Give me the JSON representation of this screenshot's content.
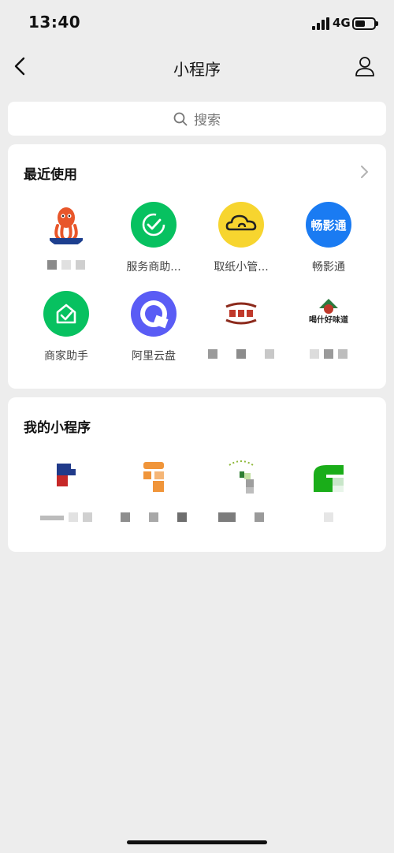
{
  "status_bar": {
    "time": "13:40",
    "network": "4G"
  },
  "nav": {
    "title": "小程序"
  },
  "search": {
    "placeholder": "搜索"
  },
  "recent": {
    "title": "最近使用",
    "apps": [
      {
        "label": "",
        "icon": "octopus-mascot-icon"
      },
      {
        "label": "服务商助...",
        "icon": "check-circle-icon",
        "color": "#07c160"
      },
      {
        "label": "取纸小管...",
        "icon": "cloud-icon",
        "color": "#f7d52f"
      },
      {
        "label": "畅影通",
        "icon": "changyingtong-logo",
        "logo_text": "畅影通",
        "color": "#1a7bf2"
      },
      {
        "label": "商家助手",
        "icon": "shop-check-icon",
        "color": "#07c160"
      },
      {
        "label": "阿里云盘",
        "icon": "aliyun-drive-icon",
        "color": "#5a5cf5"
      },
      {
        "label": "",
        "icon": "pattern-logo-icon"
      },
      {
        "label": "",
        "icon": "food-brand-logo",
        "logo_text": "喝什好味道"
      }
    ]
  },
  "mine": {
    "title": "我的小程序",
    "apps": [
      {
        "label": "",
        "icon": "blue-red-logo"
      },
      {
        "label": "",
        "icon": "orange-block-logo",
        "color": "#f0953a"
      },
      {
        "label": "",
        "icon": "green-leaf-logo"
      },
      {
        "label": "",
        "icon": "green-house-logo",
        "color": "#1aad19"
      }
    ]
  },
  "colors": {
    "background": "#ededed",
    "card": "#ffffff",
    "wechat_green": "#07c160"
  }
}
